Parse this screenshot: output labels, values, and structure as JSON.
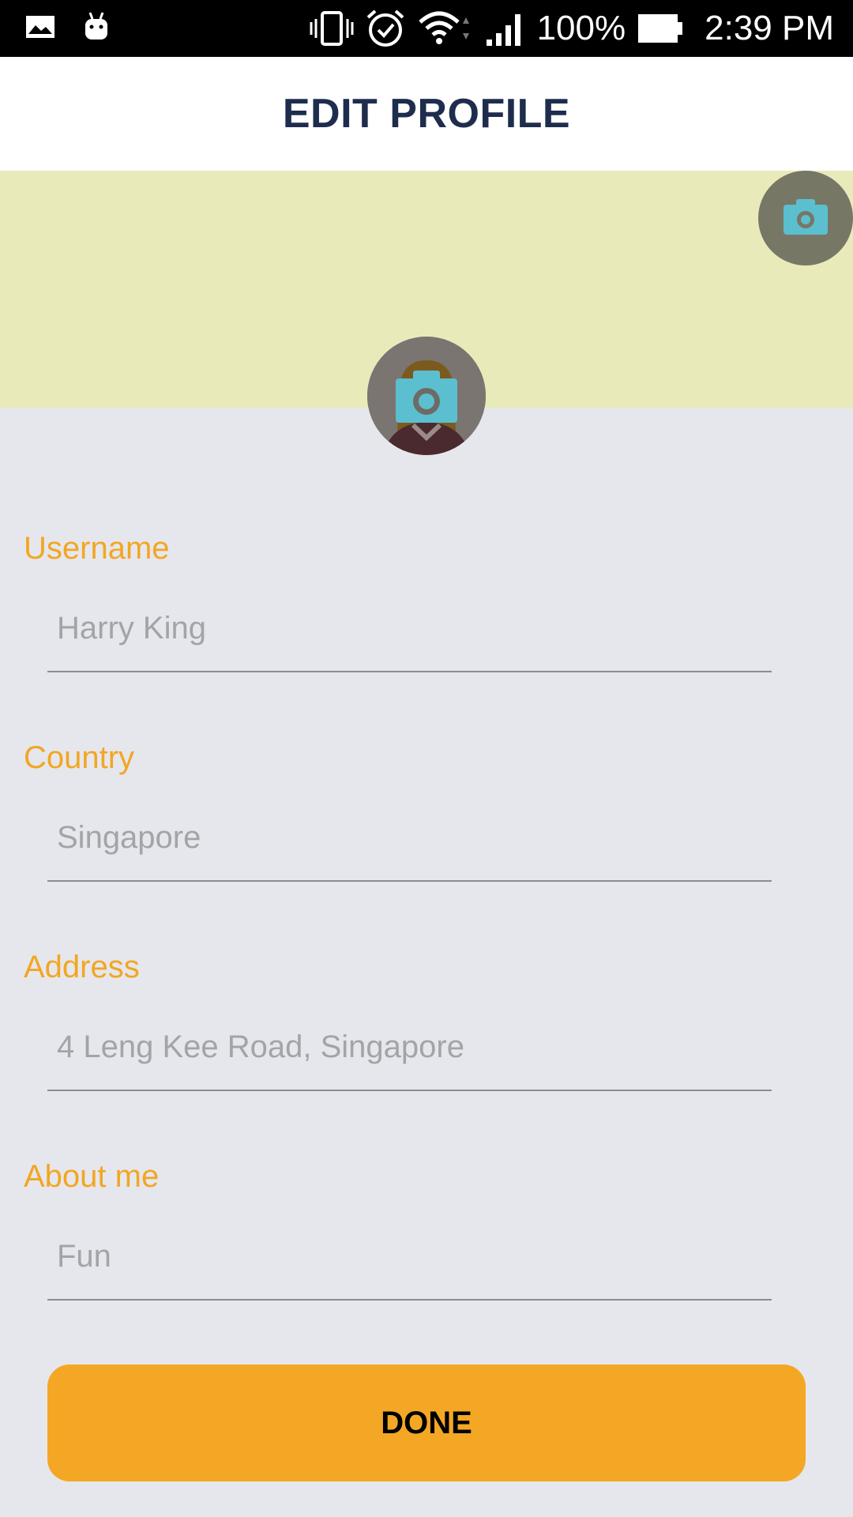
{
  "status_bar": {
    "battery": "100%",
    "time": "2:39 PM"
  },
  "header": {
    "title": "EDIT PROFILE"
  },
  "colors": {
    "accent": "#f4a724",
    "label": "#f2a623",
    "title": "#1e2d4d",
    "cover": "#e9eab9",
    "camera_icon": "#5bbfd0",
    "background": "#e6e7ec"
  },
  "icons": {
    "cover_camera": "camera-icon",
    "avatar_camera": "camera-icon"
  },
  "form": {
    "username": {
      "label": "Username",
      "value": "Harry King"
    },
    "country": {
      "label": "Country",
      "value": "Singapore"
    },
    "address": {
      "label": "Address",
      "value": "4 Leng Kee Road, Singapore"
    },
    "about": {
      "label": "About me",
      "value": "Fun"
    }
  },
  "actions": {
    "done_label": "DONE"
  }
}
